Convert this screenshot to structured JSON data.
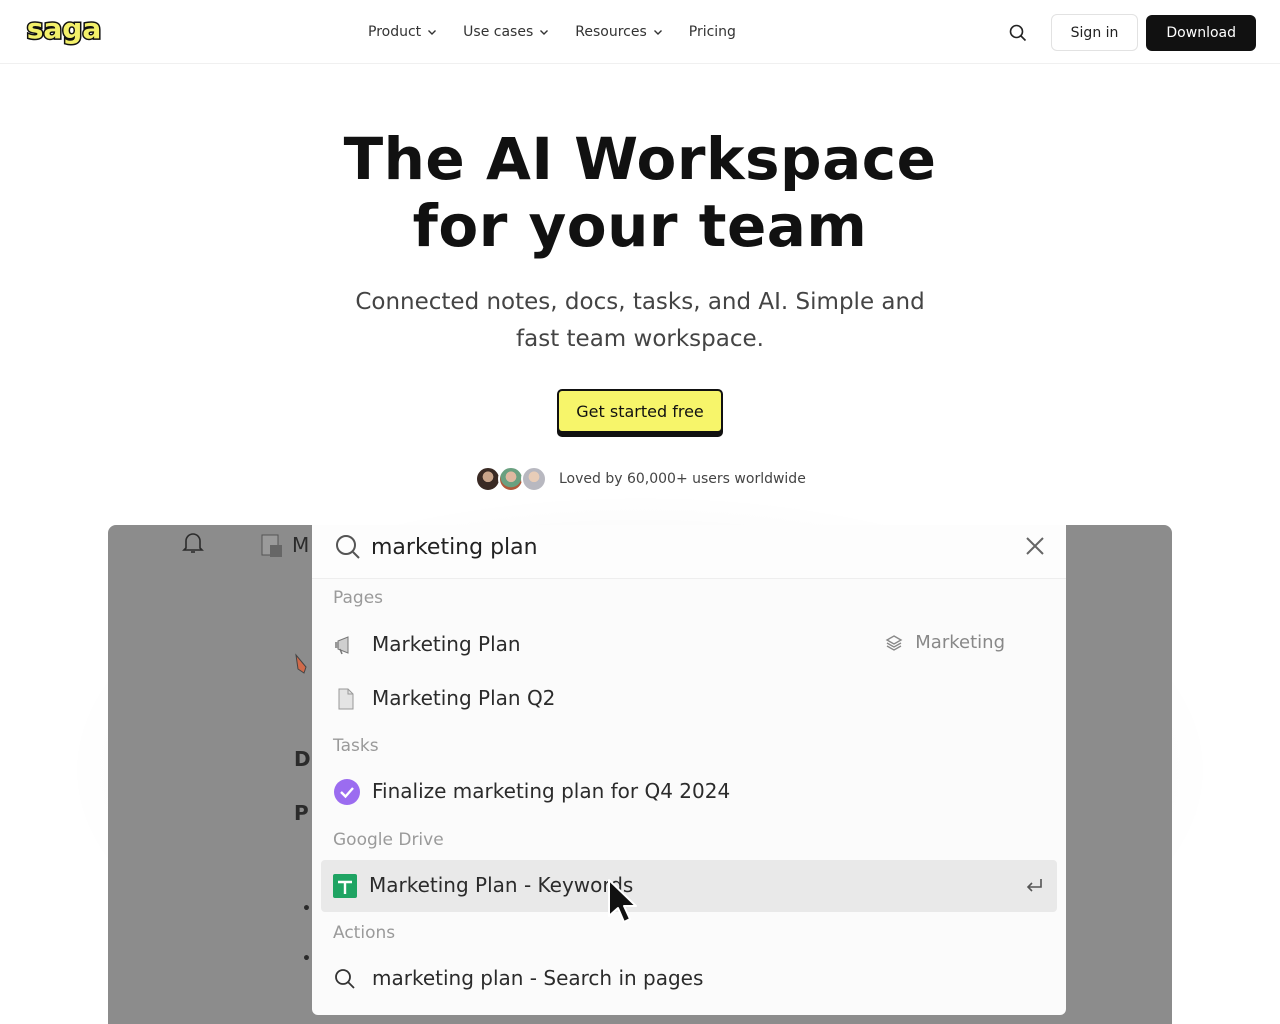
{
  "nav": {
    "logo_text": "saga",
    "links": [
      {
        "label": "Product",
        "dropdown": true
      },
      {
        "label": "Use cases",
        "dropdown": true
      },
      {
        "label": "Resources",
        "dropdown": true
      },
      {
        "label": "Pricing",
        "dropdown": false
      }
    ],
    "signin_label": "Sign in",
    "download_label": "Download"
  },
  "hero": {
    "title_line1": "The AI Workspace",
    "title_line2": "for your team",
    "subtitle": "Connected notes, docs, tasks, and AI. Simple and fast team workspace.",
    "cta_label": "Get started free",
    "social_proof": "Loved by 60,000+ users worldwide"
  },
  "palette": {
    "query": "marketing plan",
    "sections": {
      "pages": "Pages",
      "tasks": "Tasks",
      "drive": "Google Drive",
      "actions": "Actions"
    },
    "pages": [
      {
        "title": "Marketing Plan",
        "meta": "Marketing",
        "icon": "megaphone-icon"
      },
      {
        "title": "Marketing Plan Q2",
        "meta": "",
        "icon": "document-icon"
      }
    ],
    "tasks": [
      {
        "title": "Finalize marketing plan for Q4 2024",
        "done": true
      }
    ],
    "drive": [
      {
        "title": "Marketing Plan - Keywords",
        "icon": "google-sheets-icon",
        "highlighted": true
      }
    ],
    "actions": [
      {
        "title": "marketing plan - Search in pages",
        "icon": "search-icon"
      }
    ]
  },
  "background_app": {
    "partial_letters": [
      "M",
      "D",
      "P"
    ]
  },
  "colors": {
    "accent_yellow": "#f7f56a",
    "logo_yellow": "#f3f06a",
    "task_purple": "#9b6cf0",
    "sheets_green": "#1fa463"
  }
}
